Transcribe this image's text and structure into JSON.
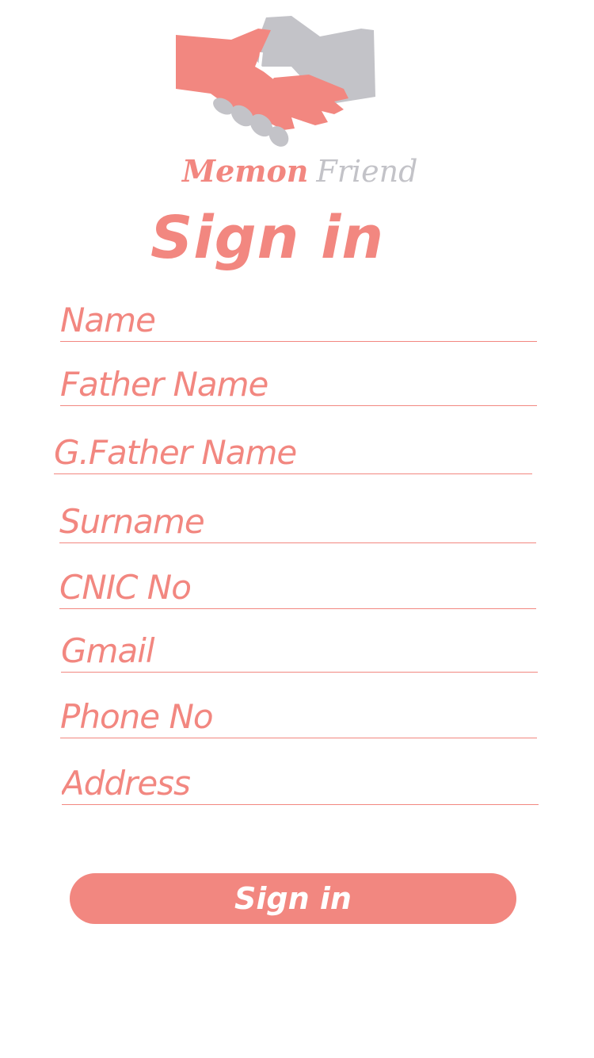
{
  "brand": {
    "word1": "Memon",
    "word2": "Friend",
    "colors": {
      "primary": "#f28780",
      "secondary": "#c3c3c8"
    }
  },
  "title": "Sign in",
  "form": {
    "fields": [
      {
        "placeholder": "Name"
      },
      {
        "placeholder": "Father Name"
      },
      {
        "placeholder": "G.Father Name"
      },
      {
        "placeholder": "Surname"
      },
      {
        "placeholder": "CNIC No"
      },
      {
        "placeholder": "Gmail"
      },
      {
        "placeholder": "Phone No"
      },
      {
        "placeholder": "Address"
      }
    ],
    "submit_label": "Sign in"
  }
}
